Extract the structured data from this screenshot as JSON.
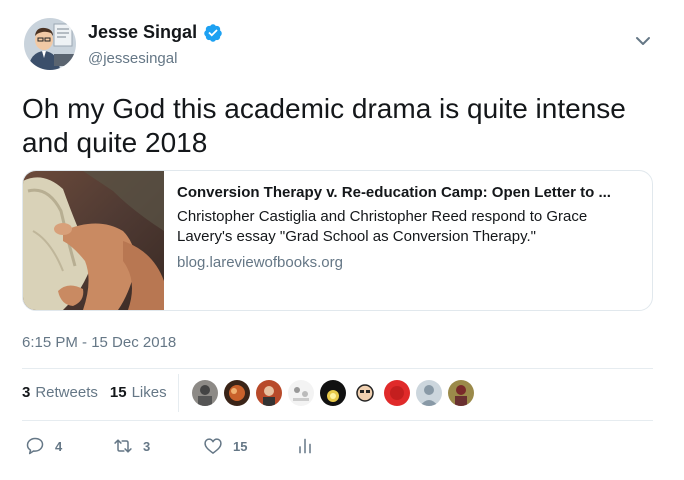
{
  "author": {
    "display_name": "Jesse Singal",
    "handle": "@jessesingal",
    "verified": true,
    "avatar_icon": "cartoon-avatar-icon"
  },
  "tweet": {
    "text": "Oh my God this academic drama is quite intense and quite 2018",
    "timestamp": "6:15 PM - 15 Dec 2018"
  },
  "card": {
    "title": "Conversion Therapy v. Re-education Camp: Open Letter to ...",
    "description": "Christopher Castiglia and Christopher Reed respond to Grace Lavery's essay \"Grad School as Conversion Therapy.\"",
    "domain": "blog.lareviewofbooks.org"
  },
  "stats": {
    "retweets_count": "3",
    "retweets_label": "Retweets",
    "likes_count": "15",
    "likes_label": "Likes"
  },
  "likers": [
    {
      "icon": "liker-avatar-1"
    },
    {
      "icon": "liker-avatar-2"
    },
    {
      "icon": "liker-avatar-3"
    },
    {
      "icon": "liker-avatar-4"
    },
    {
      "icon": "liker-avatar-5"
    },
    {
      "icon": "liker-avatar-6"
    },
    {
      "icon": "liker-avatar-7"
    },
    {
      "icon": "liker-avatar-8"
    },
    {
      "icon": "liker-avatar-9"
    }
  ],
  "actions": {
    "reply_count": "4",
    "retweet_count": "3",
    "like_count": "15"
  },
  "colors": {
    "verified_blue": "#1da1f2",
    "secondary_text": "#657786",
    "border": "#e1e8ed"
  }
}
